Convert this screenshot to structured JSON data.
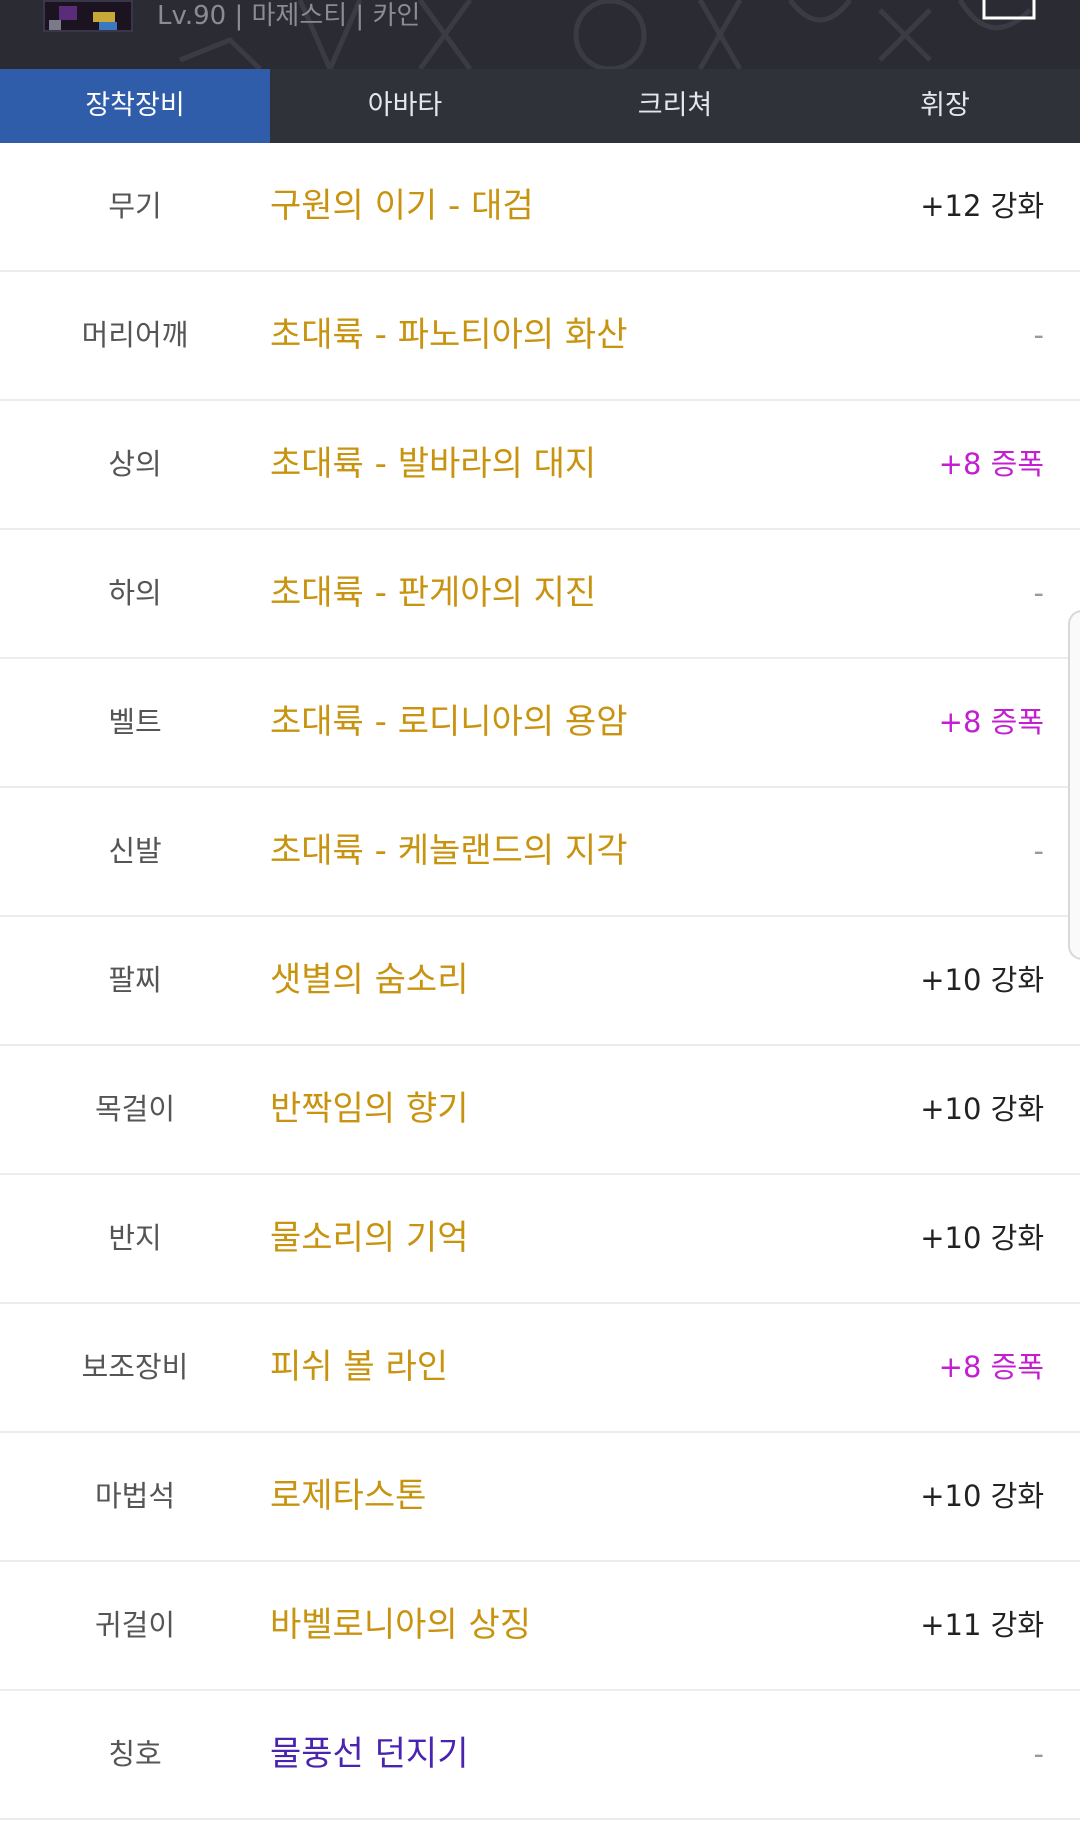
{
  "header": {
    "character_info": "Lv.90 | 마제스티 | 카인",
    "avatar_icon": "character-avatar",
    "cart_icon": "bag-icon"
  },
  "tabs": [
    {
      "label": "장착장비",
      "active": true
    },
    {
      "label": "아바타",
      "active": false
    },
    {
      "label": "크리쳐",
      "active": false
    },
    {
      "label": "휘장",
      "active": false
    }
  ],
  "colors": {
    "tab_active": "#2f5da9",
    "item_epic": "#c8930f",
    "item_title": "#4a24b0",
    "amplify": "#c31fd1"
  },
  "equipment": [
    {
      "slot": "무기",
      "item": "구원의 이기 - 대검",
      "enhance": "+12 강화",
      "type": "reinforce"
    },
    {
      "slot": "머리어깨",
      "item": "초대륙 - 파노티아의 화산",
      "enhance": "-",
      "type": "none"
    },
    {
      "slot": "상의",
      "item": "초대륙 - 발바라의 대지",
      "enhance": "+8 증폭",
      "type": "amp"
    },
    {
      "slot": "하의",
      "item": "초대륙 - 판게아의 지진",
      "enhance": "-",
      "type": "none"
    },
    {
      "slot": "벨트",
      "item": "초대륙 - 로디니아의 용암",
      "enhance": "+8 증폭",
      "type": "amp"
    },
    {
      "slot": "신발",
      "item": "초대륙 - 케놀랜드의 지각",
      "enhance": "-",
      "type": "none"
    },
    {
      "slot": "팔찌",
      "item": "샛별의 숨소리",
      "enhance": "+10 강화",
      "type": "reinforce"
    },
    {
      "slot": "목걸이",
      "item": "반짝임의 향기",
      "enhance": "+10 강화",
      "type": "reinforce"
    },
    {
      "slot": "반지",
      "item": "물소리의 기억",
      "enhance": "+10 강화",
      "type": "reinforce"
    },
    {
      "slot": "보조장비",
      "item": "피쉬 볼 라인",
      "enhance": "+8 증폭",
      "type": "amp"
    },
    {
      "slot": "마법석",
      "item": "로제타스톤",
      "enhance": "+10 강화",
      "type": "reinforce"
    },
    {
      "slot": "귀걸이",
      "item": "바벨로니아의 상징",
      "enhance": "+11 강화",
      "type": "reinforce"
    },
    {
      "slot": "칭호",
      "item": "물풍선 던지기",
      "enhance": "-",
      "type": "none",
      "title": true
    }
  ]
}
